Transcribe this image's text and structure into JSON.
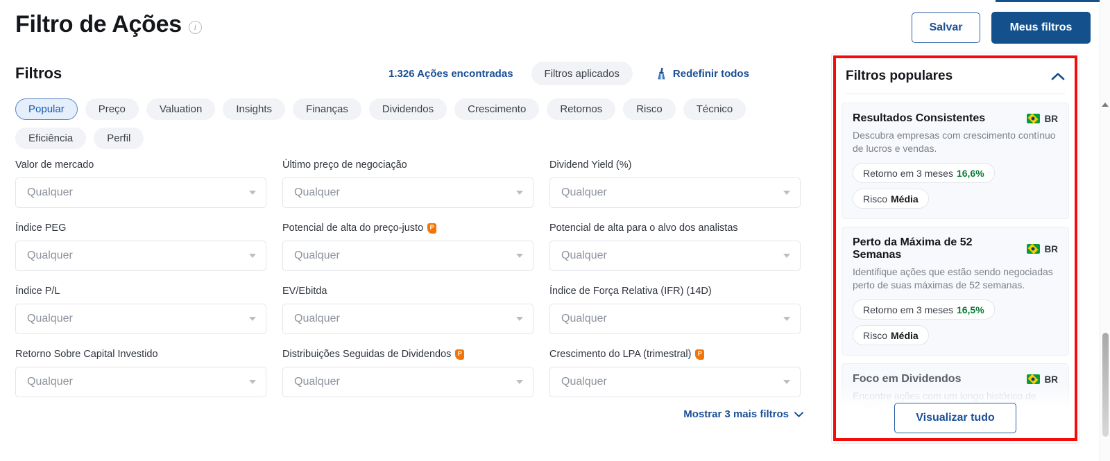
{
  "header": {
    "title": "Filtro de Ações",
    "info_icon": "info-icon",
    "save_label": "Salvar",
    "my_filters_label": "Meus filtros"
  },
  "filters_bar": {
    "heading": "Filtros",
    "results_count": "1.326 Ações encontradas",
    "applied_chip": "Filtros aplicados",
    "reset_all": "Redefinir todos",
    "reset_icon": "broom-icon"
  },
  "categories": {
    "row1": [
      {
        "label": "Popular",
        "active": true
      },
      {
        "label": "Preço",
        "active": false
      },
      {
        "label": "Valuation",
        "active": false
      },
      {
        "label": "Insights",
        "active": false
      },
      {
        "label": "Finanças",
        "active": false
      },
      {
        "label": "Dividendos",
        "active": false
      },
      {
        "label": "Crescimento",
        "active": false
      },
      {
        "label": "Retornos",
        "active": false
      },
      {
        "label": "Risco",
        "active": false
      },
      {
        "label": "Técnico",
        "active": false
      }
    ],
    "row2": [
      {
        "label": "Eficiência",
        "active": false
      },
      {
        "label": "Perfil",
        "active": false
      }
    ]
  },
  "fields": [
    {
      "label": "Valor de mercado",
      "pro": false,
      "value": "Qualquer"
    },
    {
      "label": "Último preço de negociação",
      "pro": false,
      "value": "Qualquer"
    },
    {
      "label": "Dividend Yield (%)",
      "pro": false,
      "value": "Qualquer"
    },
    {
      "label": "Índice PEG",
      "pro": false,
      "value": "Qualquer"
    },
    {
      "label": "Potencial de alta do preço-justo",
      "pro": true,
      "value": "Qualquer"
    },
    {
      "label": "Potencial de alta para o alvo dos analistas",
      "pro": false,
      "value": "Qualquer"
    },
    {
      "label": "Índice P/L",
      "pro": false,
      "value": "Qualquer"
    },
    {
      "label": "EV/Ebitda",
      "pro": false,
      "value": "Qualquer"
    },
    {
      "label": "Índice de Força Relativa (IFR) (14D)",
      "pro": false,
      "value": "Qualquer"
    },
    {
      "label": "Retorno Sobre Capital Investido",
      "pro": false,
      "value": "Qualquer"
    },
    {
      "label": "Distribuições Seguidas de Dividendos",
      "pro": true,
      "value": "Qualquer"
    },
    {
      "label": "Crescimento do LPA (trimestral)",
      "pro": true,
      "value": "Qualquer"
    }
  ],
  "show_more": {
    "label": "Mostrar 3 mais filtros",
    "icon": "chevron-down-icon"
  },
  "popular_panel": {
    "title": "Filtros populares",
    "collapse_icon": "chevron-up-icon",
    "view_all_label": "Visualizar tudo",
    "cards": [
      {
        "title": "Resultados Consistentes",
        "country": "BR",
        "description": "Descubra empresas com crescimento contínuo de lucros e vendas.",
        "return_label": "Retorno em 3 meses",
        "return_value": "16,6%",
        "risk_label": "Risco",
        "risk_value": "Média"
      },
      {
        "title": "Perto da Máxima de 52 Semanas",
        "country": "BR",
        "description": "Identifique ações que estão sendo negociadas perto de suas máximas de 52 semanas.",
        "return_label": "Retorno em 3 meses",
        "return_value": "16,5%",
        "risk_label": "Risco",
        "risk_value": "Média"
      },
      {
        "title": "Foco em Dividendos",
        "country": "BR",
        "description": "Encontre ações com um longo histórico de pagamentos consistentes de dividendos.",
        "return_label": "",
        "return_value": "",
        "risk_label": "",
        "risk_value": ""
      }
    ]
  },
  "colors": {
    "brand_blue": "#14508c",
    "link_blue": "#1a4f96",
    "highlight_red": "#f20d0d",
    "pro_orange": "#f2750a",
    "gain_green": "#0a7c34",
    "chip_bg": "#f1f3f6",
    "chip_active_bg": "#e5eefb"
  }
}
